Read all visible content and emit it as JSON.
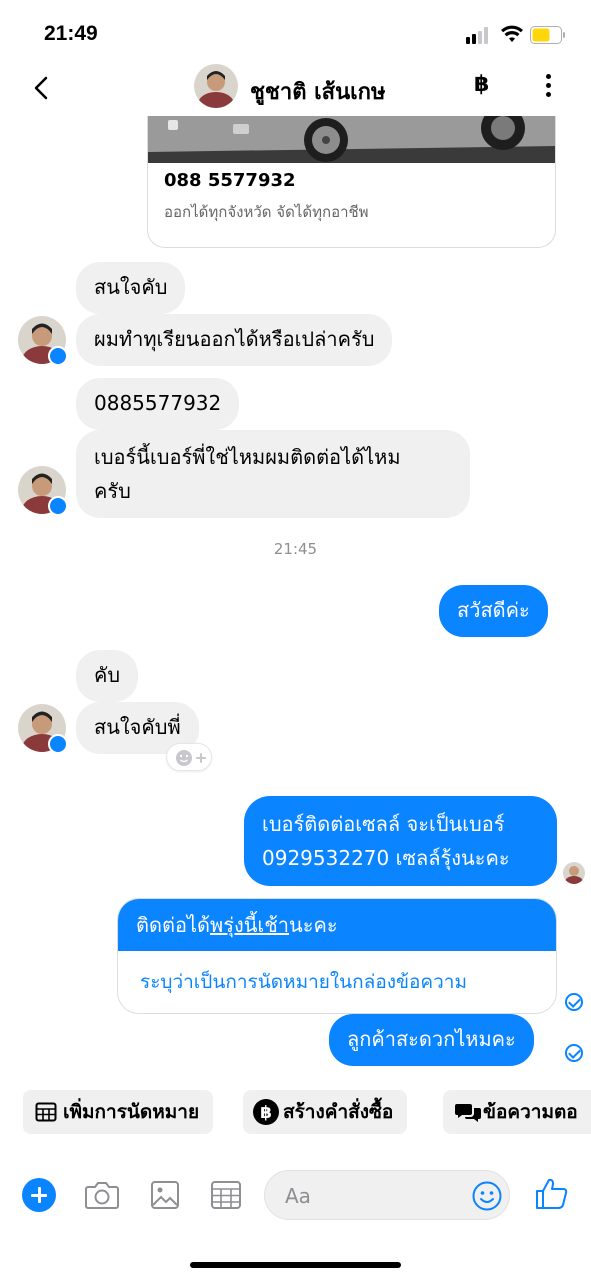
{
  "status_bar": {
    "time": "21:49"
  },
  "header": {
    "contact_name": "ชูชาติ เส้นเกษ",
    "baht_symbol": "฿"
  },
  "card": {
    "phone": "088 5577932",
    "subtitle": "ออกได้ทุกจังหวัด จัดได้ทุกอาชีพ"
  },
  "messages": [
    {
      "dir": "in",
      "text": "สนใจคับ"
    },
    {
      "dir": "in",
      "text": "ผมทำทุเรียนออกได้หรือเปล่าครับ"
    },
    {
      "dir": "in",
      "text": "0885577932"
    },
    {
      "dir": "in",
      "text": "เบอร์นี้เบอร์พี่ใช่ไหมผมติดต่อได้ไหม"
    },
    {
      "dir": "in",
      "text": "ครับ"
    },
    {
      "dir": "out",
      "text": "สวัสดีค่ะ"
    },
    {
      "dir": "in",
      "text": "คับ"
    },
    {
      "dir": "in",
      "text": "สนใจคับพี่"
    },
    {
      "dir": "out",
      "text": "เบอร์ติดต่อเซลล์ จะเป็นเบอร์"
    },
    {
      "dir": "out",
      "text": "0929532270 เซลล์รุ้งนะคะ"
    },
    {
      "dir": "out",
      "text": "ลูกค้าสะดวกไหมคะ"
    }
  ],
  "timestamp": "21:45",
  "appointment": {
    "prefix": "ติดต่อได้",
    "underlined": "พรุ่งนี้เช้า",
    "suffix": "นะคะ",
    "note": "ระบุว่าเป็นการนัดหมายในกล่องข้อความ"
  },
  "chips": [
    {
      "label": "เพิ่มการนัดหมาย",
      "icon": "calendar-icon"
    },
    {
      "label": "สร้างคำสั่งซื้อ",
      "icon": "baht-icon",
      "symbol": "฿"
    },
    {
      "label": "ข้อความตอ",
      "icon": "chat-bubbles-icon"
    }
  ],
  "composer": {
    "placeholder": "Aa"
  },
  "colors": {
    "accent": "#0a84ff",
    "incoming_bubble": "#f0f0f0",
    "battery": "#ffd60a"
  }
}
